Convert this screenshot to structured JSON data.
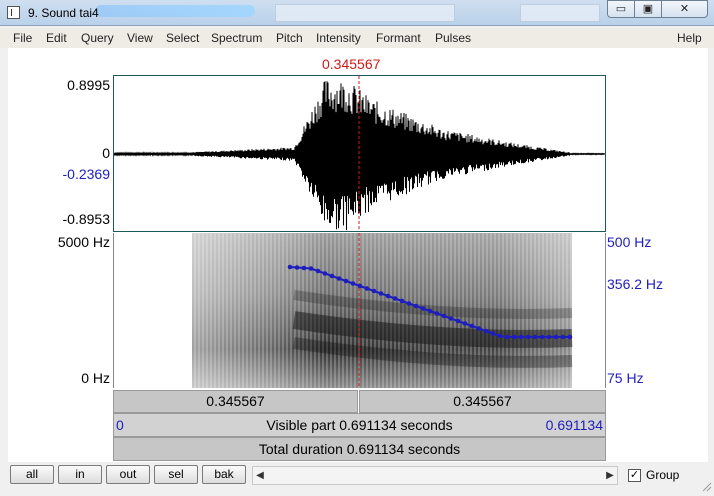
{
  "window": {
    "title": "9. Sound tai4",
    "minimize_glyph": "▭",
    "maximize_glyph": "▣",
    "close_glyph": "✕"
  },
  "menu": [
    "File",
    "Edit",
    "Query",
    "View",
    "Select",
    "Spectrum",
    "Pitch",
    "Intensity",
    "Formant",
    "Pulses",
    "Help"
  ],
  "cursor": {
    "time_label": "0.345567",
    "color": "#d01818"
  },
  "waveform": {
    "max_label": "0.8995",
    "zero_label": "0",
    "cursor_value_label": "-0.2369",
    "min_label": "-0.8953"
  },
  "spectrogram": {
    "top_freq_label": "5000 Hz",
    "bottom_freq_label": "0 Hz"
  },
  "pitch": {
    "top_label": "500 Hz",
    "current_label": "356.2 Hz",
    "bottom_label": "75 Hz",
    "color": "#1e1ebe"
  },
  "time_bars": {
    "left_segment": "0.345567",
    "right_segment": "0.345567",
    "visible_start": "0",
    "visible_text": "Visible part 0.691134 seconds",
    "visible_end": "0.691134",
    "total_text": "Total duration 0.691134 seconds"
  },
  "toolbar": {
    "buttons": [
      "all",
      "in",
      "out",
      "sel",
      "bak"
    ],
    "scroll_left": "◀",
    "scroll_right": "▶",
    "group_checked": true,
    "group_check_glyph": "✓",
    "group_label": "Group"
  }
}
